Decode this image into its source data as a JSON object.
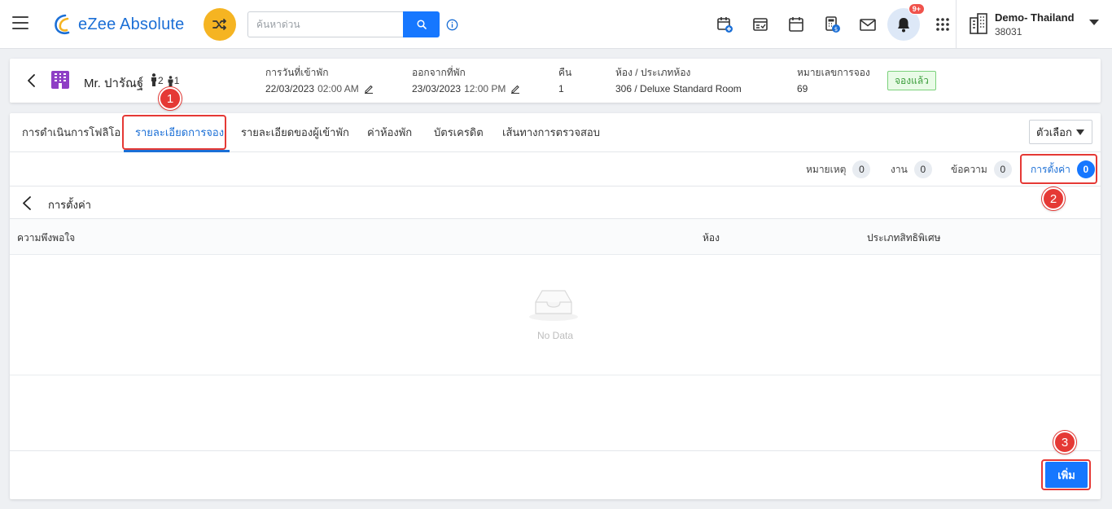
{
  "app": {
    "name": "eZee Absolute"
  },
  "search": {
    "placeholder": "ค้นหาด่วน"
  },
  "notifications": {
    "badge": "9+"
  },
  "property": {
    "name": "Demo- Thailand",
    "code": "38031"
  },
  "booking": {
    "guest_name": "Mr. ปารัณฐ์",
    "adults": "2",
    "children": "1",
    "arrival_label": "การวันที่เข้าพัก",
    "arrival_date": "22/03/2023",
    "arrival_time": "02:00 AM",
    "departure_label": "ออกจากที่พัก",
    "departure_date": "23/03/2023",
    "departure_time": "12:00 PM",
    "nights_label": "คืน",
    "nights": "1",
    "room_label": "ห้อง / ประเภทห้อง",
    "room": "306 / Deluxe Standard Room",
    "res_label": "หมายเลขการจอง",
    "res_no": "69",
    "status": "จองแล้ว"
  },
  "tabs": [
    {
      "label": "การดำเนินการโฟลิโอ"
    },
    {
      "label": "รายละเอียดการจอง"
    },
    {
      "label": "รายละเอียดของผู้เข้าพัก"
    },
    {
      "label": "ค่าห้องพัก"
    },
    {
      "label": "บัตรเครดิต"
    },
    {
      "label": "เส้นทางการตรวจสอบ"
    }
  ],
  "options_label": "ตัวเลือก",
  "subtabs": [
    {
      "label": "หมายเหตุ",
      "count": "0"
    },
    {
      "label": "งาน",
      "count": "0"
    },
    {
      "label": "ข้อความ",
      "count": "0"
    },
    {
      "label": "การตั้งค่า",
      "count": "0"
    }
  ],
  "preferences": {
    "title": "การตั้งค่า",
    "columns": [
      "ความพึงพอใจ",
      "ห้อง",
      "ประเภทสิทธิพิเศษ"
    ],
    "empty_text": "No Data",
    "add_label": "เพิ่ม"
  },
  "callouts": [
    "1",
    "2",
    "3"
  ],
  "colors": {
    "brand": "#1b6fd6",
    "accent": "#1677ff",
    "highlight": "#e53935"
  }
}
